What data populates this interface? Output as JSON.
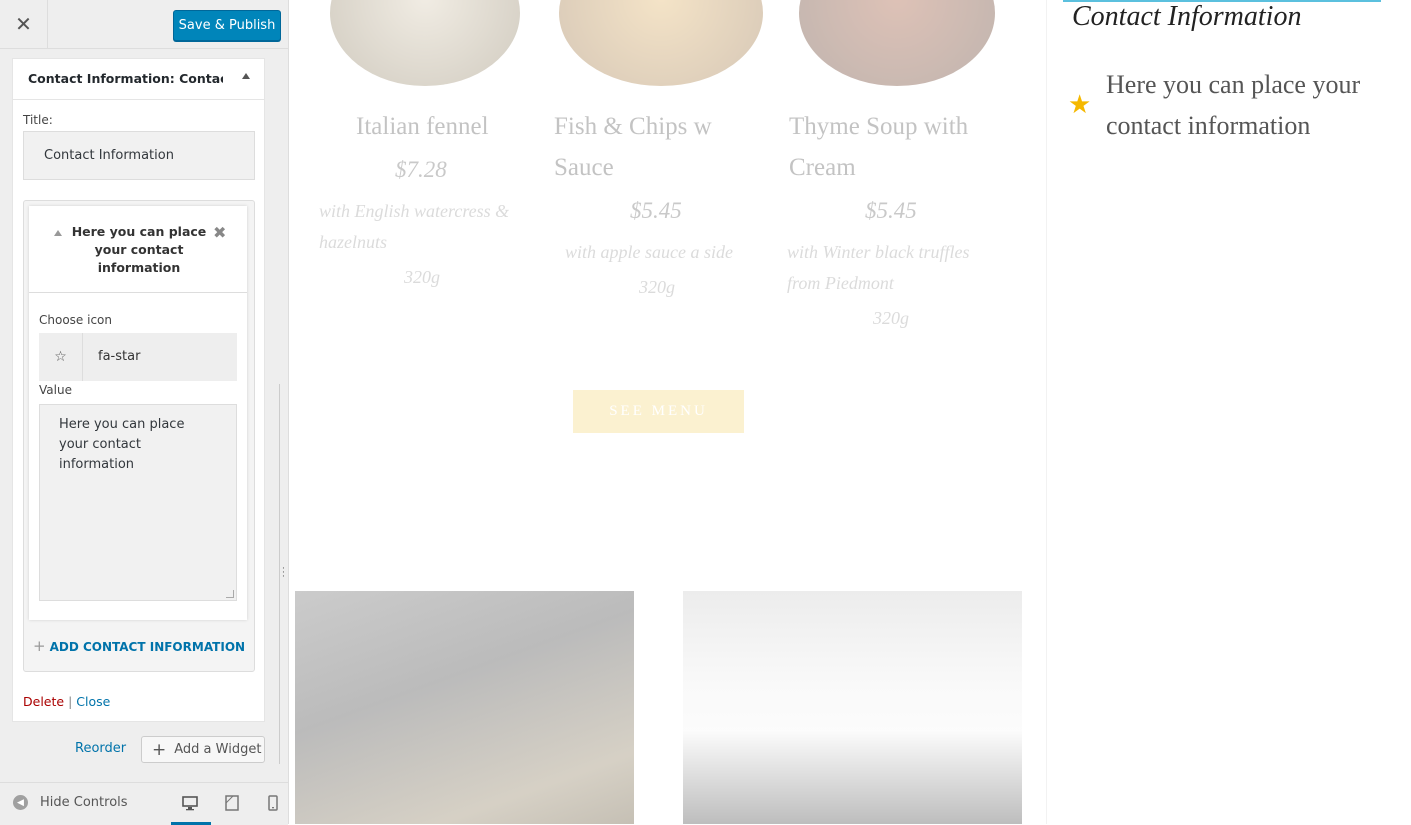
{
  "header": {
    "close_icon": "close-icon",
    "save_label": "Save & Publish",
    "save_color": "#0085ba"
  },
  "widget": {
    "title": "Contact Information: Contact...",
    "title_label": "Title:",
    "title_value": "Contact Information",
    "item": {
      "title": "Here you can place your contact information",
      "choose_icon_label": "Choose icon",
      "icon_value": "fa-star",
      "value_label": "Value",
      "value_text": "Here you can place your contact information"
    },
    "add_contact_label": "ADD CONTACT INFORMATION",
    "delete_label": "Delete",
    "separator": "|",
    "close_label": "Close"
  },
  "actions": {
    "reorder_label": "Reorder",
    "add_widget_label": "Add a Widget"
  },
  "footer": {
    "hide_controls_label": "Hide Controls",
    "devices": [
      "desktop-icon",
      "tablet-icon",
      "mobile-icon"
    ],
    "active_device": "desktop"
  },
  "preview": {
    "dishes": [
      {
        "name": "Italian fennel",
        "price": "$7.28",
        "desc": "with English watercress & hazelnuts",
        "weight": "320g"
      },
      {
        "name": "Fish & Chips w Sauce",
        "price": "$5.45",
        "desc": "with apple sauce a side",
        "weight": "320g"
      },
      {
        "name": "Thyme Soup with Cream",
        "price": "$5.45",
        "desc": "with Winter black truffles from Piedmont",
        "weight": "320g"
      }
    ],
    "see_menu_label": "SEE MENU",
    "contact_heading": "Contact Information",
    "contact_icon": "star-icon",
    "contact_text": "Here you can place your contact information",
    "accent_color": "#f5b800"
  }
}
